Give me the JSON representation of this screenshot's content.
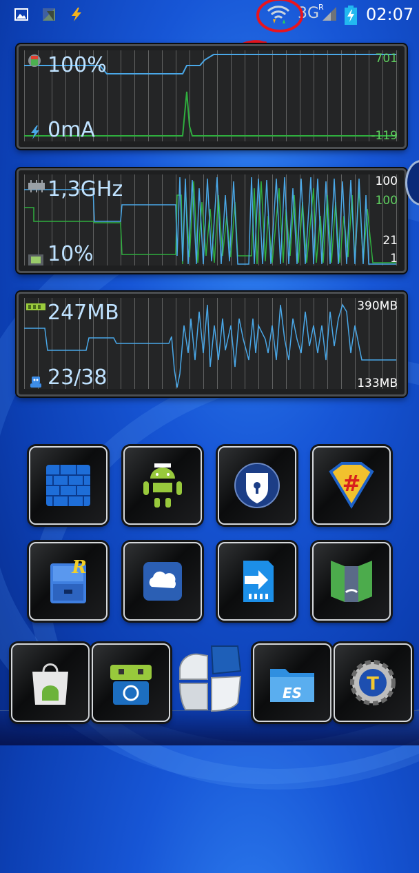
{
  "status_bar": {
    "time": "02:07",
    "network_type": "3G",
    "roaming_indicator": "R",
    "icons": [
      "gallery-icon",
      "app-notification-icon",
      "flash-icon",
      "wifi-icon",
      "signal-icon",
      "battery-charging-icon"
    ]
  },
  "battery_widget": {
    "level": "100%",
    "current": "0mA",
    "range_max": "701",
    "range_min": "-119"
  },
  "cpu_widget": {
    "frequency": "1,3GHz",
    "load": "10%",
    "scale_top": "100",
    "scale_top2": "100",
    "scale_low": "21",
    "scale_bottom": "1"
  },
  "memory_widget": {
    "free_memory": "247MB",
    "process_count": "23/38",
    "range_max": "390MB",
    "range_min": "133MB"
  },
  "apps": [
    {
      "name": "firewall-app",
      "icon": "brick-wall-icon"
    },
    {
      "name": "android-tuner-app",
      "icon": "android-robot-icon"
    },
    {
      "name": "privacy-guard-app",
      "icon": "shield-lock-icon"
    },
    {
      "name": "superuser-app",
      "icon": "superman-hash-icon"
    },
    {
      "name": "root-explorer-app",
      "icon": "file-cabinet-icon"
    },
    {
      "name": "cloud-app",
      "icon": "cloud-icon"
    },
    {
      "name": "app-to-sd-app",
      "icon": "sd-card-arrow-icon"
    },
    {
      "name": "network-app",
      "icon": "green-frame-icon"
    }
  ],
  "dock": [
    {
      "name": "play-store-app",
      "icon": "shopping-bag-android-icon"
    },
    {
      "name": "f-droid-app",
      "icon": "f-droid-robot-icon"
    },
    {
      "name": "launcher-home",
      "icon": "cube-icon"
    },
    {
      "name": "es-file-explorer-app",
      "icon": "es3-folder-icon"
    },
    {
      "name": "titanium-backup-app",
      "icon": "titanium-gear-icon"
    }
  ],
  "colors": {
    "background": "#1756d6",
    "trace_blue": "#4aa8e8",
    "trace_green": "#2fae3e",
    "annotation_red": "#e8141e",
    "value_text": "#bfe2ff"
  }
}
